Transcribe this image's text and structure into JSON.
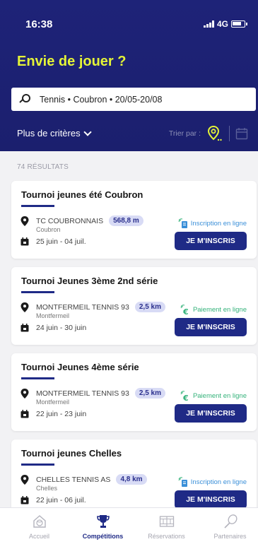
{
  "status": {
    "time": "16:38",
    "network": "4G"
  },
  "header": {
    "title": "Envie de jouer ?",
    "search": "Tennis • Coubron • 20/05-20/08",
    "criteria": "Plus de critères",
    "sort_label": "Trier par :"
  },
  "results_count": "74 RÉSULTATS",
  "cards": [
    {
      "title": "Tournoi jeunes été Coubron",
      "club": "TC COUBRONNAIS",
      "distance": "568,8 m",
      "city": "Coubron",
      "dates": "25 juin - 04 juil.",
      "payment": "Inscription en ligne",
      "button": "JE M'INSCRIS"
    },
    {
      "title": "Tournoi Jeunes 3ème 2nd série",
      "club": "MONTFERMEIL TENNIS 93",
      "distance": "2,5 km",
      "city": "Montfermeil",
      "dates": "24 juin - 30 juin",
      "payment": "Paiement en ligne",
      "button": "JE M'INSCRIS"
    },
    {
      "title": "Tournoi Jeunes 4ème série",
      "club": "MONTFERMEIL TENNIS 93",
      "distance": "2,5 km",
      "city": "Montfermeil",
      "dates": "22 juin - 23 juin",
      "payment": "Paiement en ligne",
      "button": "JE M'INSCRIS"
    },
    {
      "title": "Tournoi jeunes Chelles",
      "club": "CHELLES TENNIS AS",
      "distance": "4,8 km",
      "city": "Chelles",
      "dates": "22 juin - 06 juil.",
      "payment": "Inscription en ligne",
      "button": "JE M'INSCRIS"
    }
  ],
  "tabs": [
    {
      "label": "Accueil"
    },
    {
      "label": "Compétitions"
    },
    {
      "label": "Réservations"
    },
    {
      "label": "Partenaires"
    }
  ],
  "colors": {
    "header_bg": "#1e2378",
    "accent_yellow": "#e4f437",
    "button_blue": "#1f2a86",
    "online_green": "#34b27a",
    "online_blue": "#3a8fd8"
  }
}
